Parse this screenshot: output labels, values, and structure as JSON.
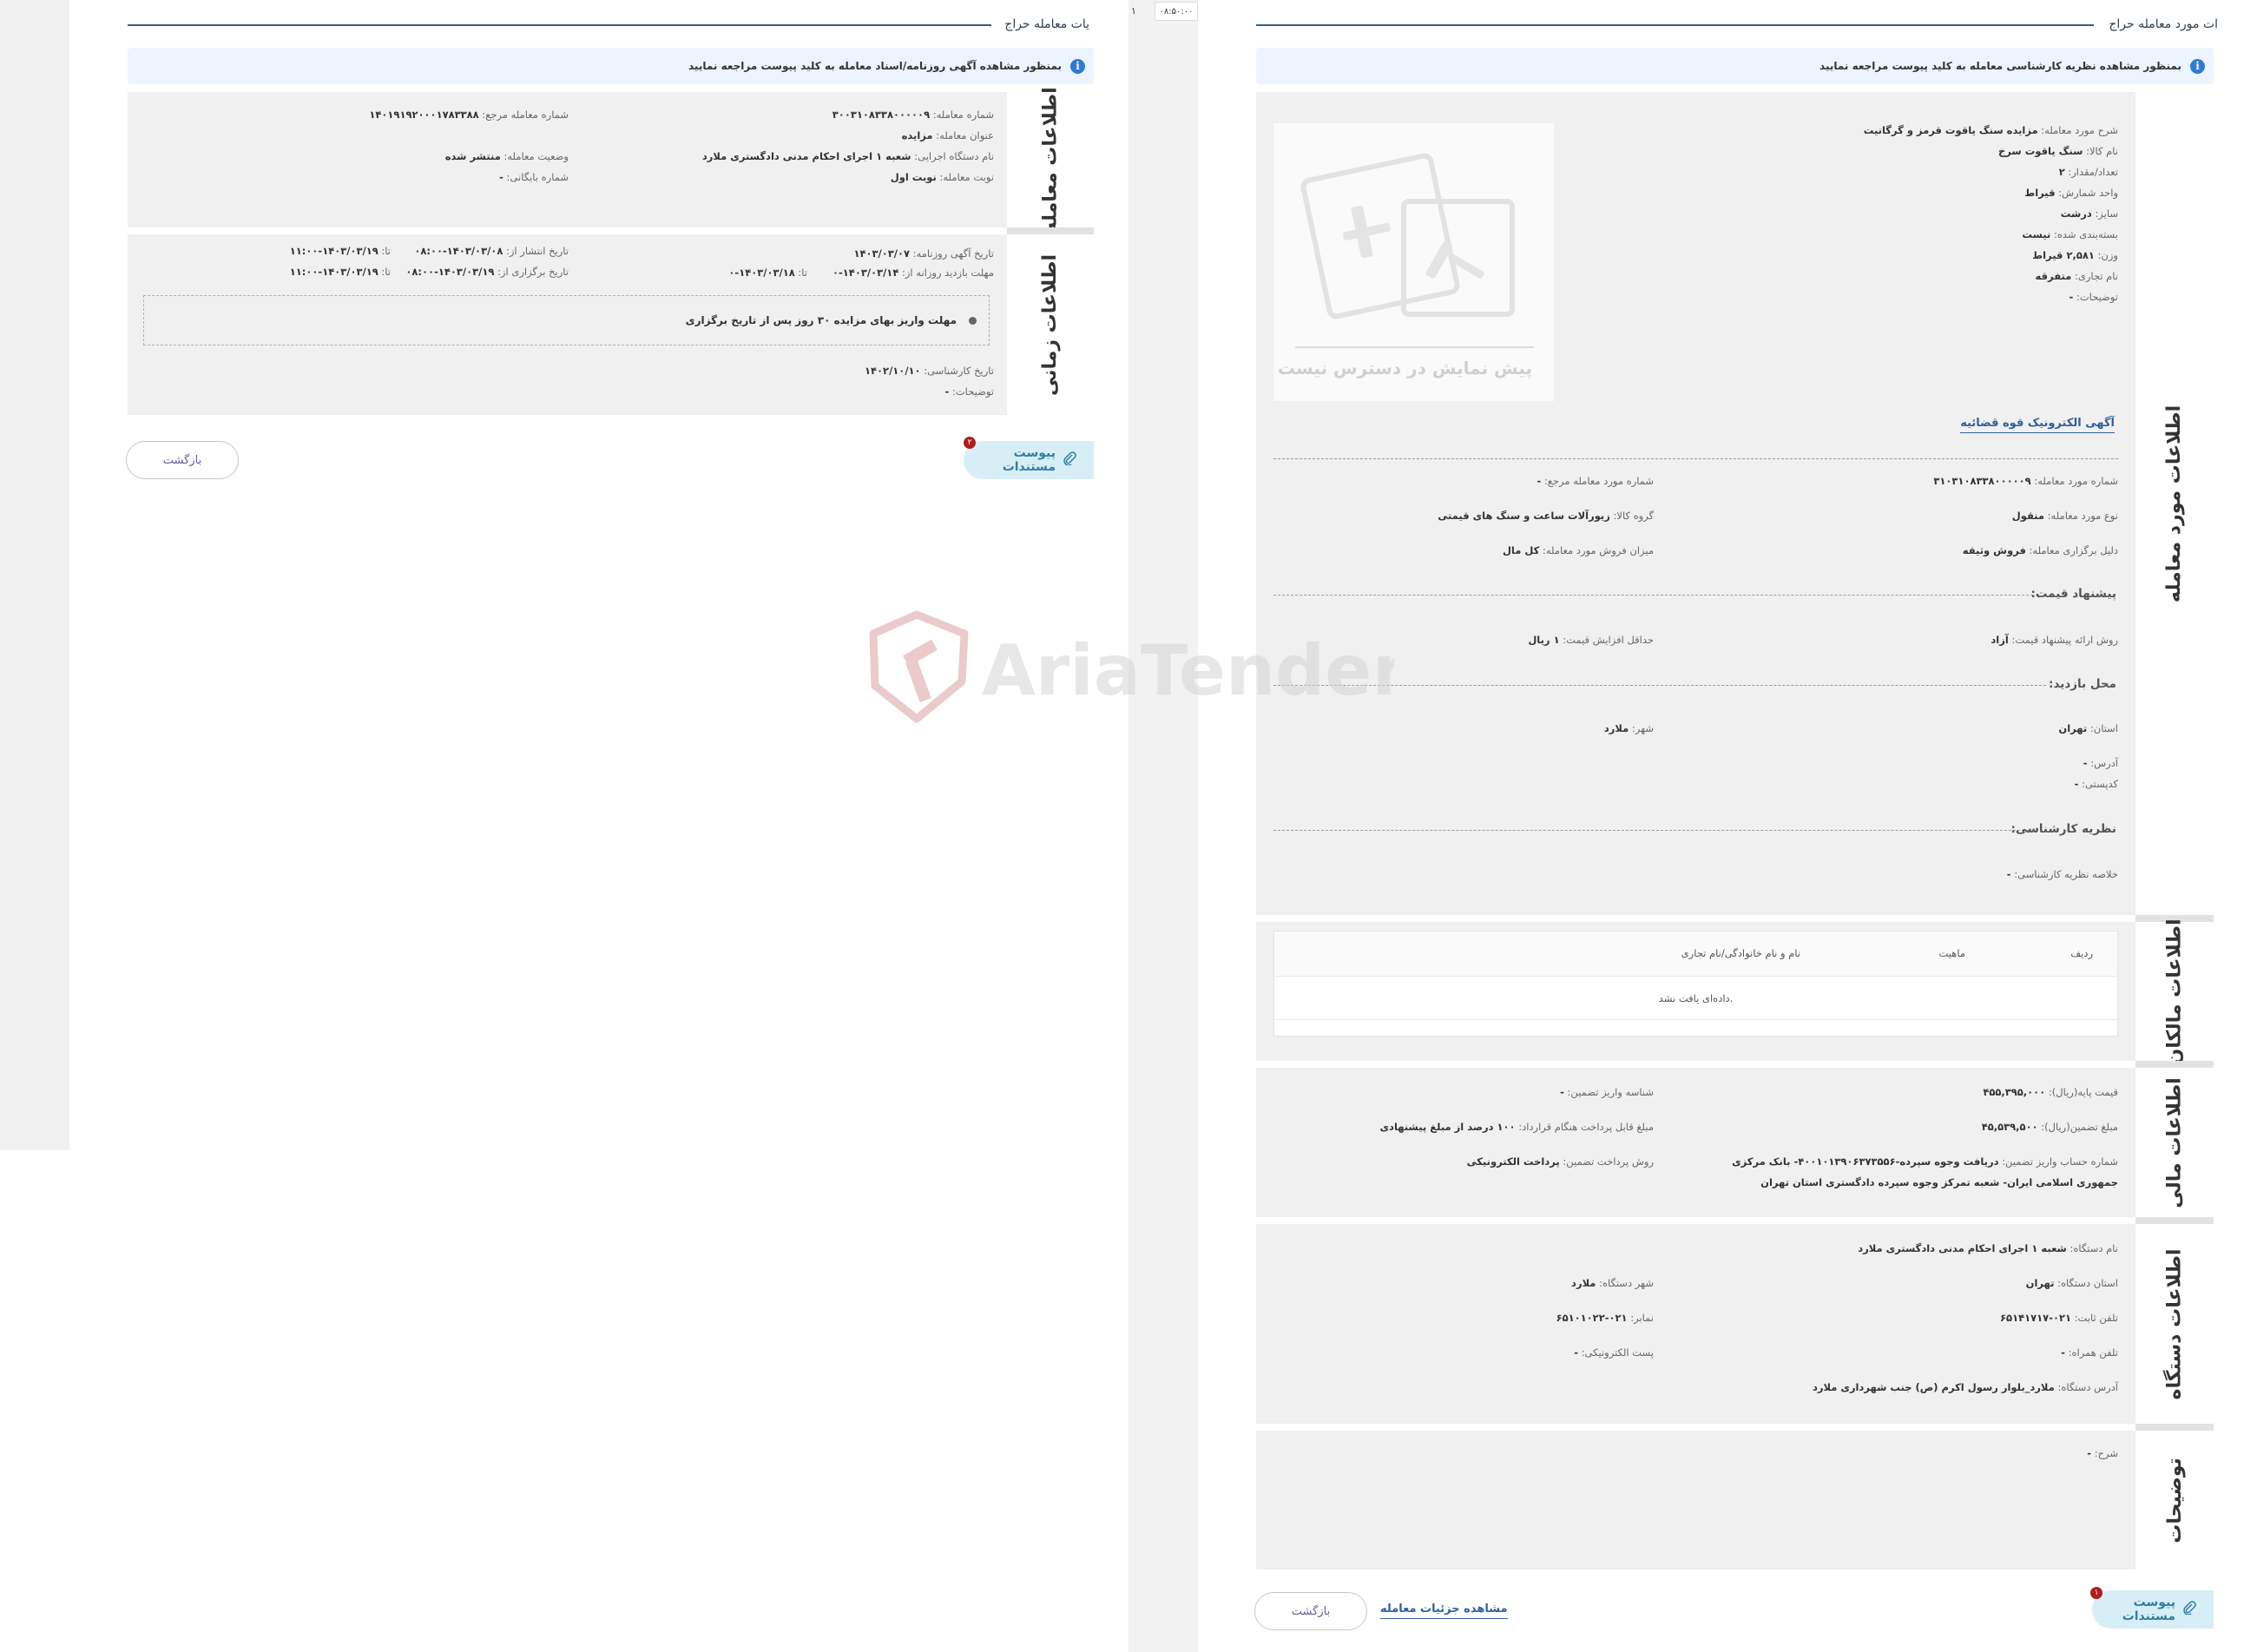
{
  "left_page": {
    "header": "یات معامله حراج",
    "notice": "بمنظور مشاهده آگهی روزنامه/اسناد معامله به کلید پیوست مراجعه نمایید",
    "deal_tab": "اطلاعات معامله",
    "deal_fields": {
      "deal_no": {
        "k": "شماره معامله:",
        "v": "۳۰۰۳۱۰۸۳۳۸۰۰۰۰۰۹"
      },
      "ref_no": {
        "k": "شماره معامله مرجع:",
        "v": "۱۴۰۱۹۱۹۲۰۰۰۱۷۸۳۳۸۸"
      },
      "title": {
        "k": "عنوان معامله:",
        "v": "مزایده"
      },
      "agency": {
        "k": "نام دستگاه اجرایی:",
        "v": "شعبه ۱ اجرای احکام مدنی دادگستری ملارد"
      },
      "status": {
        "k": "وضعیت معامله:",
        "v": "منتشر شده"
      },
      "turn": {
        "k": "نوبت معامله:",
        "v": "نوبت اول"
      },
      "archive": {
        "k": "شماره بایگانی:",
        "v": "-"
      }
    },
    "time_tab": "اطلاعات زمانی",
    "time_fields": {
      "ad_date": {
        "k": "تاریخ آگهی روزنامه:",
        "v": "۱۴۰۳/۰۳/۰۷"
      },
      "publish_from": {
        "k": "تاریخ انتشار از:",
        "v": "۱۴۰۳/۰۳/۰۸-۰۸:۰۰"
      },
      "publish_to": {
        "k": "تا:",
        "v": "۱۴۰۳/۰۳/۱۹-۱۱:۰۰"
      },
      "visit_from": {
        "k": "مهلت بازدید روزانه از:",
        "v": "۱۴۰۳/۰۳/۱۴-۰"
      },
      "visit_to": {
        "k": "تا:",
        "v": "۱۴۰۳/۰۳/۱۸-۰"
      },
      "hold_from": {
        "k": "تاریخ برگزاری از:",
        "v": "۱۴۰۳/۰۳/۱۹-۰۸:۰۰"
      },
      "hold_to": {
        "k": "تا:",
        "v": "۱۴۰۳/۰۳/۱۹-۱۱:۰۰"
      },
      "expert_date": {
        "k": "تاریخ کارشناسی:",
        "v": "۱۴۰۲/۱۰/۱۰"
      },
      "desc": {
        "k": "توضیحات:",
        "v": "-"
      }
    },
    "deadline_note": "مهلت واریز بهای مزایده ۳۰ روز پس از تاریخ برگزاری",
    "attach_label": "پیوست مستندات",
    "attach_badge": "۲",
    "back_label": "بازگشت"
  },
  "divider": {
    "marker": "۱",
    "time": "۰۸:۵۰:۰۰"
  },
  "right_page": {
    "header": "ات مورد معامله حراج",
    "notice": "بمنظور مشاهده نظریه کارشناسی معامله به کلید پیوست مراجعه نمایید",
    "item_tab": "اطلاعات مورد معامله",
    "item_fields": {
      "desc": {
        "k": "شرح مورد معامله:",
        "v": "مزایده سنگ یاقوت قرمز و گرگانیت"
      },
      "goods": {
        "k": "نام کالا:",
        "v": "سنگ یاقوت سرخ"
      },
      "qty": {
        "k": "تعداد/مقدار:",
        "v": "۲"
      },
      "unit": {
        "k": "واحد شمارش:",
        "v": "قیراط"
      },
      "size": {
        "k": "سایز:",
        "v": "درشت"
      },
      "packaging": {
        "k": "بسته‌بندی شده:",
        "v": "نیست"
      },
      "weight": {
        "k": "وزن:",
        "v": "۲,۵۸۱ قیراط"
      },
      "brand": {
        "k": "نام تجاری:",
        "v": "متفرقه"
      },
      "notes": {
        "k": "توضیحات:",
        "v": "-"
      }
    },
    "preview_text": "پیش نمایش در دسترس نیست",
    "ad_link": "آگهی الکترونیک قوه قضائیه",
    "item_meta": {
      "item_no": {
        "k": "شماره مورد معامله:",
        "v": "۳۱۰۳۱۰۸۳۳۸۰۰۰۰۰۹"
      },
      "item_ref": {
        "k": "شماره مورد معامله مرجع:",
        "v": "-"
      },
      "item_type": {
        "k": "نوع مورد معامله:",
        "v": "منقول"
      },
      "goods_group": {
        "k": "گروه کالا:",
        "v": "زیورآلات ساعت و سنگ های قیمتی"
      },
      "reason": {
        "k": "دلیل برگزاری معامله:",
        "v": "فروش وثیقه"
      },
      "sale_amount": {
        "k": "میزان فروش مورد معامله:",
        "v": "کل مال"
      }
    },
    "price_head": "پیشنهاد قیمت:",
    "price_fields": {
      "method": {
        "k": "روش ارائه پیشنهاد قیمت:",
        "v": "آزاد"
      },
      "min_inc": {
        "k": "حداقل افزایش قیمت:",
        "v": "۱ ریال"
      }
    },
    "visit_head": "محل بازدید:",
    "visit_fields": {
      "province": {
        "k": "استان:",
        "v": "تهران"
      },
      "city": {
        "k": "شهر:",
        "v": "ملارد"
      },
      "address": {
        "k": "آدرس:",
        "v": "-"
      },
      "postal": {
        "k": "کدپستی:",
        "v": "-"
      }
    },
    "expert_head": "نظریه کارشناسی:",
    "expert_summary": {
      "k": "خلاصه نظریه کارشناسی:",
      "v": "-"
    },
    "owners_tab": "اطلاعات مالکان",
    "owners_table": {
      "headers": [
        "ردیف",
        "ماهیت",
        "نام و نام خانوادگی/نام تجاری"
      ],
      "empty": "داده‌ای یافت نشد."
    },
    "finance_tab": "اطلاعات مالی",
    "finance_fields": {
      "base_price": {
        "k": "قیمت پایه(ریال):",
        "v": "۴۵۵,۳۹۵,۰۰۰"
      },
      "guarantee_id": {
        "k": "شناسه واریز تضمین:",
        "v": "-"
      },
      "guarantee_amount": {
        "k": "مبلغ تضمین(ریال):",
        "v": "۴۵,۵۳۹,۵۰۰"
      },
      "contract_pay": {
        "k": "مبلغ قابل پرداخت هنگام قرارداد:",
        "v": "۱۰۰ درصد از مبلغ پیشنهادی"
      },
      "account": {
        "k": "شماره حساب واریز تضمین:",
        "v": "دریافت وجوه سپرده-۴۰۰۱۰۱۳۹۰۶۳۷۳۵۵۶- بانک مرکزی"
      },
      "account_line2": "جمهوری اسلامی ایران- شعبه تمرکز وجوه سپرده دادگستری استان تهران",
      "pay_method": {
        "k": "روش پرداخت تضمین:",
        "v": "پرداخت الکترونیکی"
      }
    },
    "agency_tab": "اطلاعات دستگاه",
    "agency_fields": {
      "name": {
        "k": "نام دستگاه:",
        "v": "شعبه ۱ اجرای احکام مدنی دادگستری ملارد"
      },
      "province": {
        "k": "استان دستگاه:",
        "v": "تهران"
      },
      "city": {
        "k": "شهر دستگاه:",
        "v": "ملارد"
      },
      "phone": {
        "k": "تلفن ثابت:",
        "v": "۰۲۱-۶۵۱۴۱۷۱۷"
      },
      "fax": {
        "k": "نمابر:",
        "v": "۰۲۱-۶۵۱۰۱۰۲۲"
      },
      "mobile": {
        "k": "تلفن همراه:",
        "v": "-"
      },
      "email": {
        "k": "پست الکترونیکی:",
        "v": "-"
      },
      "address": {
        "k": "آدرس دستگاه:",
        "v": "ملارد_بلوار رسول اکرم (ص) جنب شهرداری ملارد"
      }
    },
    "desc_tab": "توضیحات",
    "desc_field": {
      "k": "شرح:",
      "v": "-"
    },
    "attach_label": "پیوست مستندات",
    "attach_badge": "۱",
    "back_label": "بازگشت",
    "deal_details_link": "مشاهده جزئیات معامله"
  },
  "watermark": {
    "text": "AriaTender.neT",
    "color": "#d9a0a0"
  }
}
